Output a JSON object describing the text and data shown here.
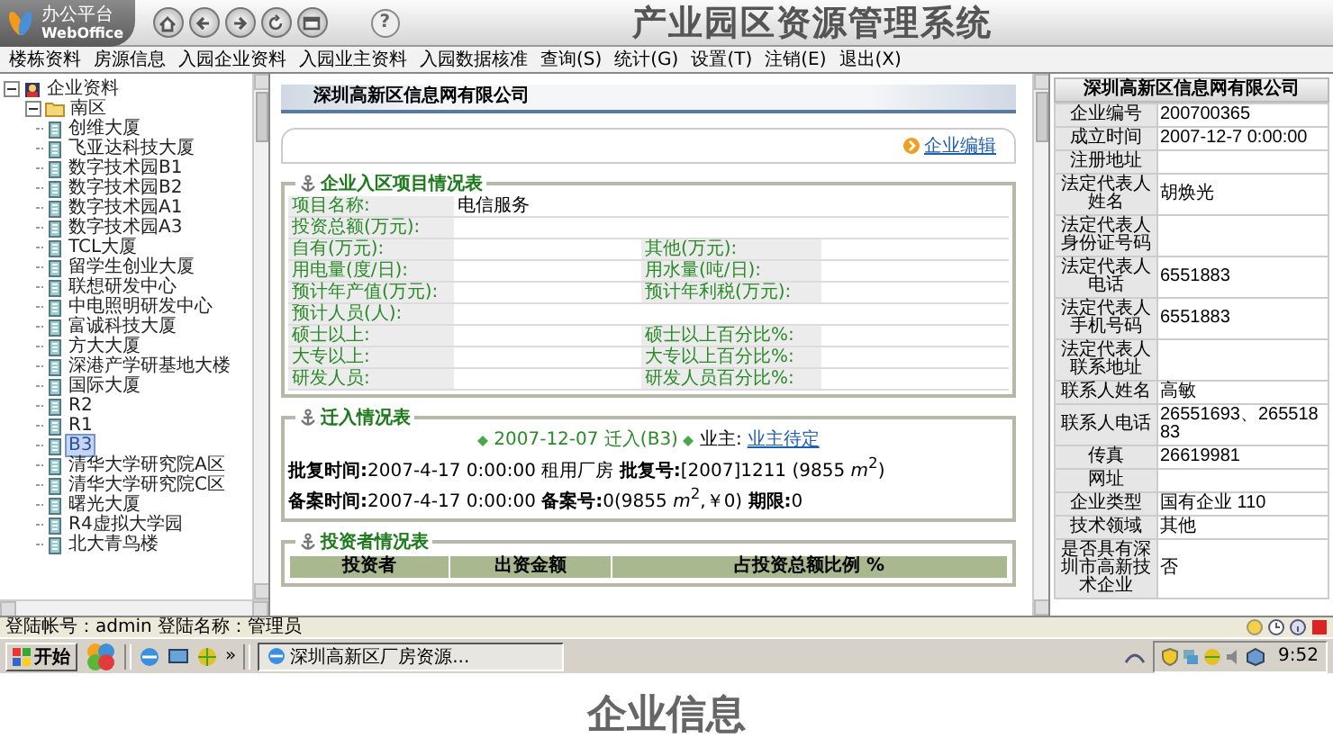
{
  "app": {
    "logo_top": "办公平台",
    "logo_bottom": "WebOffice",
    "help": "?",
    "title": "产业园区资源管理系统"
  },
  "menu": [
    {
      "label": "楼栋资料"
    },
    {
      "label": "房源信息"
    },
    {
      "label": "入园企业资料"
    },
    {
      "label": "入园业主资料"
    },
    {
      "label": "入园数据核准"
    },
    {
      "label": "查询(S)"
    },
    {
      "label": "统计(G)"
    },
    {
      "label": "设置(T)"
    },
    {
      "label": "注销(E)"
    },
    {
      "label": "退出(X)"
    }
  ],
  "tree": {
    "label": "企业资料",
    "expanded": true,
    "children": [
      {
        "label": "南区",
        "expanded": true,
        "children": [
          {
            "label": "创维大厦",
            "selected": false
          },
          {
            "label": "飞亚达科技大厦",
            "selected": false
          },
          {
            "label": "数字技术园B1",
            "selected": false
          },
          {
            "label": "数字技术园B2",
            "selected": false
          },
          {
            "label": "数字技术园A1",
            "selected": false
          },
          {
            "label": "数字技术园A3",
            "selected": false
          },
          {
            "label": "TCL大厦",
            "selected": false
          },
          {
            "label": "留学生创业大厦",
            "selected": false
          },
          {
            "label": "联想研发中心",
            "selected": false
          },
          {
            "label": "中电照明研发中心",
            "selected": false
          },
          {
            "label": "富诚科技大厦",
            "selected": false
          },
          {
            "label": "方大大厦",
            "selected": false
          },
          {
            "label": "深港产学研基地大楼",
            "selected": false
          },
          {
            "label": "国际大厦",
            "selected": false
          },
          {
            "label": "R2",
            "selected": false
          },
          {
            "label": "R1",
            "selected": false
          },
          {
            "label": "B3",
            "selected": true
          },
          {
            "label": "清华大学研究院A区",
            "selected": false
          },
          {
            "label": "清华大学研究院C区",
            "selected": false
          },
          {
            "label": "曙光大厦",
            "selected": false
          },
          {
            "label": "R4虚拟大学园",
            "selected": false
          },
          {
            "label": "北大青鸟楼",
            "selected": false
          }
        ]
      }
    ]
  },
  "company_title": "深圳高新区信息网有限公司",
  "edit_link": "企业编辑",
  "project": {
    "title": "企业入区项目情况表",
    "rows": [
      [
        {
          "label": "项目名称:",
          "value": "电信服务"
        }
      ],
      [
        {
          "label": "投资总额(万元):"
        }
      ],
      [
        {
          "label": "自有(万元):"
        },
        {
          "label": "其他(万元):"
        }
      ],
      [
        {
          "label": "用电量(度/日):"
        },
        {
          "label": "用水量(吨/日):"
        }
      ],
      [
        {
          "label": "预计年产值(万元):"
        },
        {
          "label": "预计年利税(万元):"
        }
      ],
      [
        {
          "label": "预计人员(人):"
        }
      ],
      [
        {
          "label": "硕士以上:"
        },
        {
          "label": "硕士以上百分比%:"
        }
      ],
      [
        {
          "label": "大专以上:"
        },
        {
          "label": "大专以上百分比%:"
        }
      ],
      [
        {
          "label": "研发人员:"
        },
        {
          "label": "研发人员百分比%:"
        }
      ]
    ]
  },
  "move_in": {
    "title": "迁入情况表",
    "event": "2007-12-07 迁入(B3)",
    "owner_label": "业主:",
    "owner": "业主待定",
    "lines": [
      "**批复时间:**2007-4-17 0:00:00 租用厂房 **批复号:**[2007]1211 (9855 *m*$^{2}$)",
      "**备案时间:**2007-4-17 0:00:00 **备案号:**0(9855 *m*$^{2}$,￥0) **期限:**0"
    ]
  },
  "investors": {
    "title": "投资者情况表",
    "columns": [
      "投资者",
      "出资金额",
      "占投资总额比例 %"
    ]
  },
  "info": {
    "title": "深圳高新区信息网有限公司",
    "rows": [
      {
        "label": "企业编号",
        "value": "200700365"
      },
      {
        "label": "成立时间",
        "value": "2007-12-7 0:00:00"
      },
      {
        "label": "注册地址"
      },
      {
        "label": "法定代表人姓名",
        "value": "胡焕光"
      },
      {
        "label": "法定代表人身份证号码"
      },
      {
        "label": "法定代表人电话",
        "value": "6551883"
      },
      {
        "label": "法定代表人手机号码",
        "value": "6551883"
      },
      {
        "label": "法定代表人联系地址"
      },
      {
        "label": "联系人姓名",
        "value": "高敏"
      },
      {
        "label": "联系人电话",
        "value": "26551693、26551883"
      },
      {
        "label": "传真",
        "value": "26619981"
      },
      {
        "label": "网址"
      },
      {
        "label": "企业类型",
        "value": "国有企业 110"
      },
      {
        "label": "技术领域",
        "value": "其他"
      },
      {
        "label": "是否具有深圳市高新技术企业",
        "value": "否"
      }
    ]
  },
  "status_bar": {
    "text": "登陆帐号：admin 登陆名称：管理员"
  },
  "taskbar": {
    "start": "开始",
    "more": "»",
    "task": "深圳高新区厂房资源...",
    "clock": "9:52"
  },
  "caption": "企业信息"
}
